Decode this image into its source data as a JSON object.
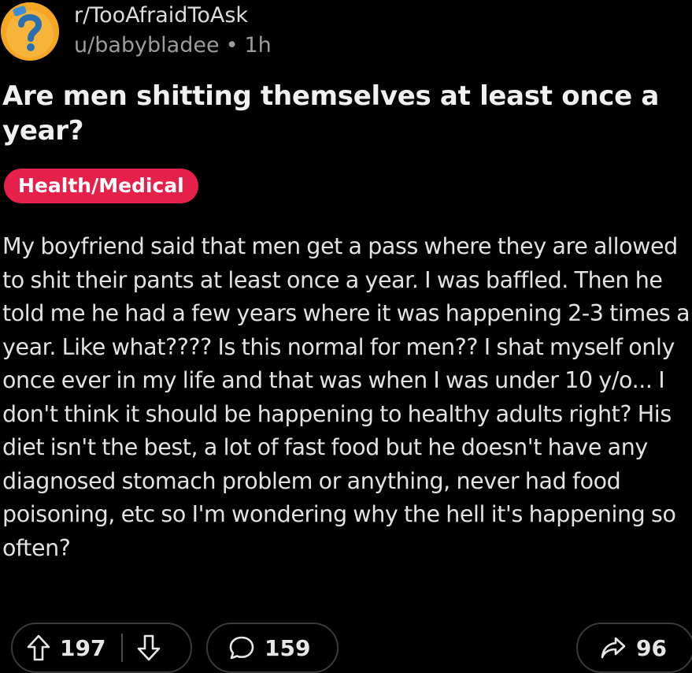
{
  "post": {
    "subreddit": "r/TooAfraidToAsk",
    "author": "u/babybladee",
    "separator": "•",
    "age": "1h",
    "title": "Are men shitting themselves at least once a year?",
    "flair": "Health/Medical",
    "body": "My boyfriend said that men get a pass where they are allowed to shit their pants at least once a year. I was baffled. Then he told me he had a few years where it was happening 2-3 times a year. Like what???? Is this normal for men?? I shat myself only once ever in my life and that was when I was under 10 y/o... I don't think it should be happening to healthy adults right? His diet isn't the best, a lot of fast food but he doesn't have any diagnosed stomach problem or anything, never had food poisoning, etc so I'm wondering why the hell it's happening so often?"
  },
  "actions": {
    "upvotes": "197",
    "comments": "159",
    "shares": "96"
  },
  "icons": {
    "avatar": "subreddit-question-mark-icon",
    "upvote": "upvote-arrow-icon",
    "downvote": "downvote-arrow-icon",
    "comment": "comment-bubble-icon",
    "share": "share-arrow-icon"
  },
  "colors": {
    "background": "#000000",
    "flair": "#e5204a",
    "avatar": "#f5a623",
    "muted_text": "#9c9c9c"
  }
}
